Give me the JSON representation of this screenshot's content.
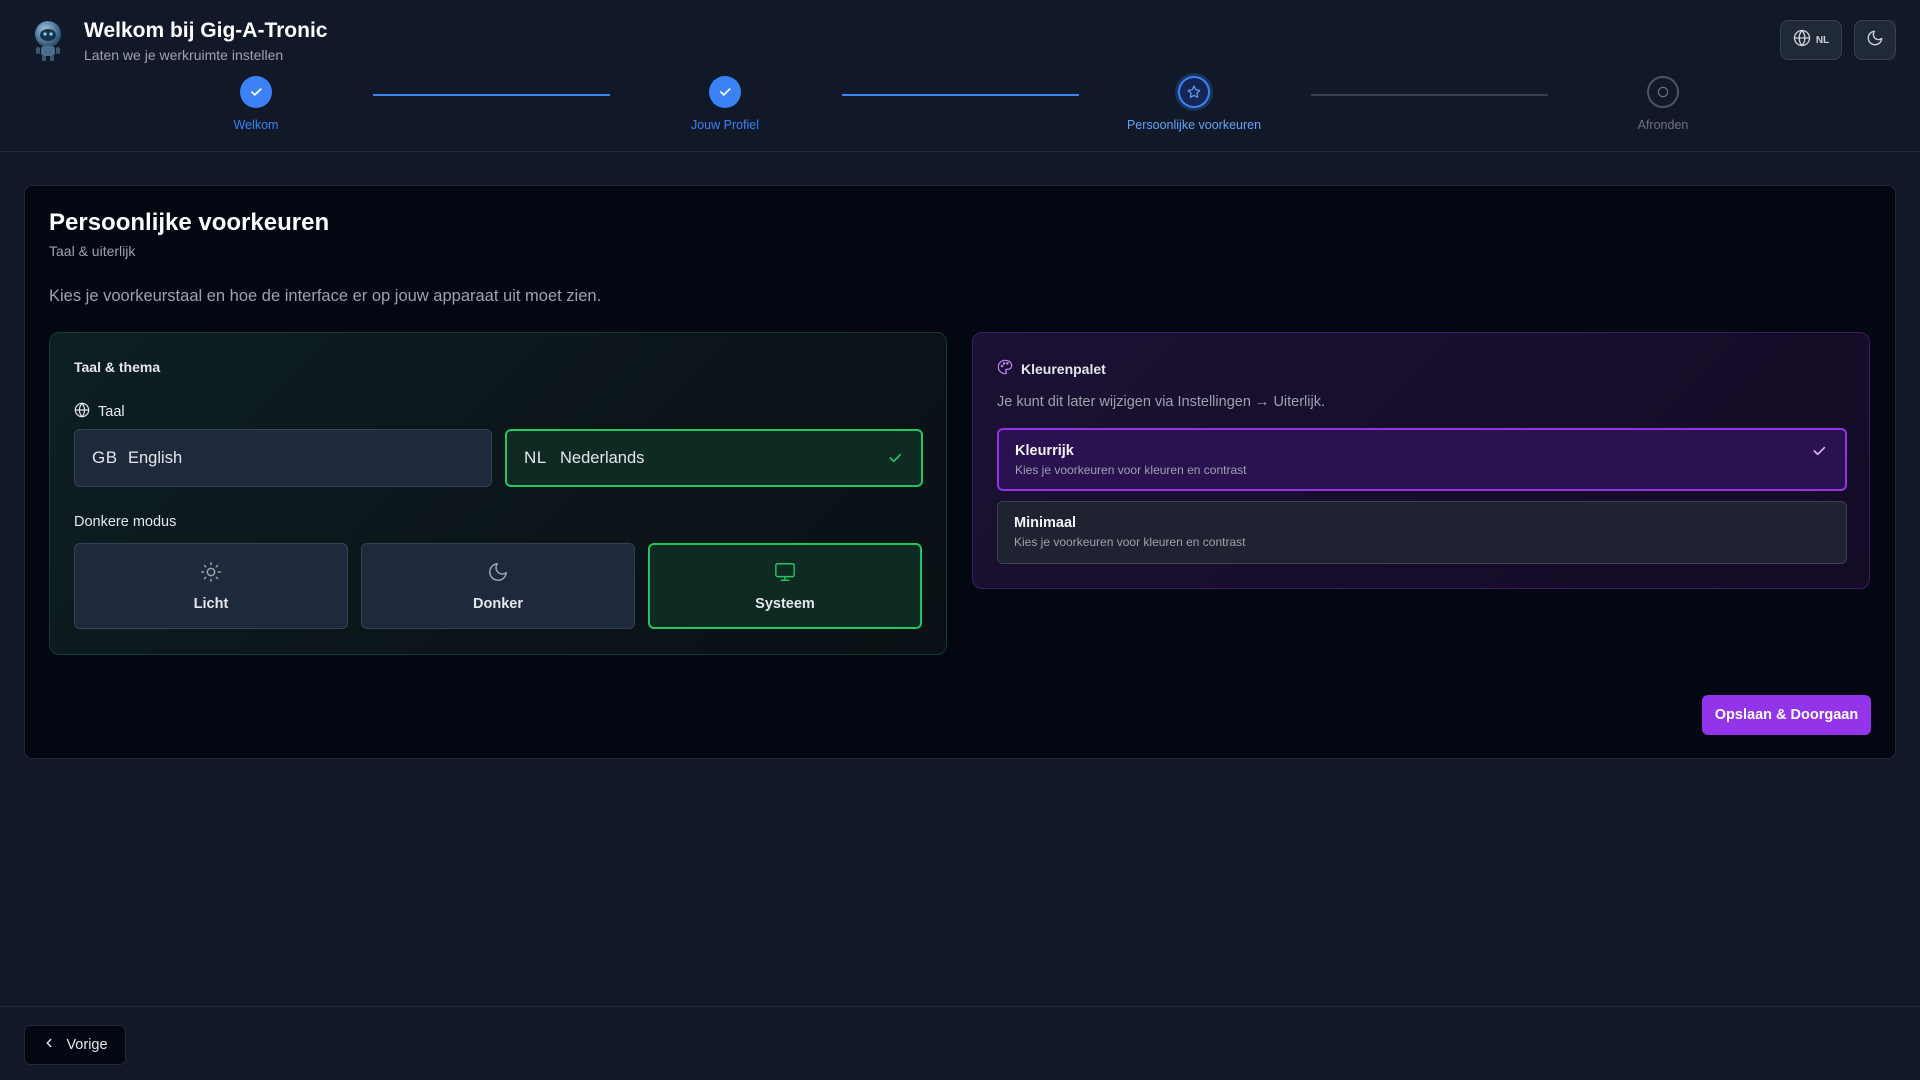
{
  "header": {
    "title": "Welkom bij Gig-A-Tronic",
    "subtitle": "Laten we je werkruimte instellen",
    "language_code": "NL"
  },
  "stepper": {
    "steps": [
      {
        "label": "Welkom",
        "state": "done"
      },
      {
        "label": "Jouw Profiel",
        "state": "done"
      },
      {
        "label": "Persoonlijke voorkeuren",
        "state": "current"
      },
      {
        "label": "Afronden",
        "state": "pending"
      }
    ]
  },
  "main": {
    "title": "Persoonlijke voorkeuren",
    "subtitle": "Taal & uiterlijk",
    "description": "Kies je voorkeurstaal en hoe de interface er op jouw apparaat uit moet zien.",
    "language_theme": {
      "title": "Taal & thema",
      "language_label": "Taal",
      "languages": [
        {
          "flag": "GB",
          "name": "English",
          "selected": false
        },
        {
          "flag": "NL",
          "name": "Nederlands",
          "selected": true
        }
      ],
      "dark_mode_label": "Donkere modus",
      "modes": [
        {
          "label": "Licht",
          "icon": "sun-icon",
          "selected": false
        },
        {
          "label": "Donker",
          "icon": "moon-icon",
          "selected": false
        },
        {
          "label": "Systeem",
          "icon": "monitor-icon",
          "selected": true
        }
      ]
    },
    "palette": {
      "title": "Kleurenpalet",
      "hint": "Je kunt dit later wijzigen via Instellingen → Uiterlijk.",
      "options": [
        {
          "name": "Kleurrijk",
          "description": "Kies je voorkeuren voor kleuren en contrast",
          "selected": true
        },
        {
          "name": "Minimaal",
          "description": "Kies je voorkeuren voor kleuren en contrast",
          "selected": false
        }
      ]
    },
    "save_label": "Opslaan & Doorgaan"
  },
  "footer": {
    "back_label": "Vorige"
  },
  "colors": {
    "background": "#111827",
    "card": "#030712",
    "accent_blue": "#3b82f6",
    "accent_green": "#22c55e",
    "accent_purple": "#9333ea"
  }
}
